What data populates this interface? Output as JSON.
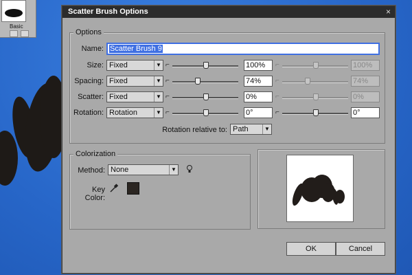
{
  "background": {
    "mini_panel_label": "Basic"
  },
  "dialog": {
    "title": "Scatter Brush Options",
    "close_glyph": "×",
    "options_legend": "Options",
    "name_label": "Name:",
    "name_value": "Scatter Brush 9",
    "rows": [
      {
        "label": "Size:",
        "select": "Fixed",
        "value": "100%",
        "value2": "100%",
        "level": 0.5,
        "level2": 0.5,
        "second_disabled": true
      },
      {
        "label": "Spacing:",
        "select": "Fixed",
        "value": "74%",
        "value2": "74%",
        "level": 0.37,
        "level2": 0.37,
        "second_disabled": true
      },
      {
        "label": "Scatter:",
        "select": "Fixed",
        "value": "0%",
        "value2": "0%",
        "level": 0.5,
        "level2": 0.5,
        "second_disabled": true
      },
      {
        "label": "Rotation:",
        "select": "Rotation",
        "value": "0°",
        "value2": "0°",
        "level": 0.5,
        "level2": 0.5,
        "second_disabled": false
      }
    ],
    "rotation_relative_label": "Rotation relative to:",
    "rotation_relative_value": "Path",
    "colorization_legend": "Colorization",
    "method_label": "Method:",
    "method_value": "None",
    "key_color_label": "Key Color:",
    "key_color": "#2b2622",
    "ok_label": "OK",
    "cancel_label": "Cancel"
  },
  "icons": {
    "tips": "lightbulb-icon",
    "eyedropper": "eyedropper-icon",
    "slider_cap": "slider-cap-icon"
  }
}
